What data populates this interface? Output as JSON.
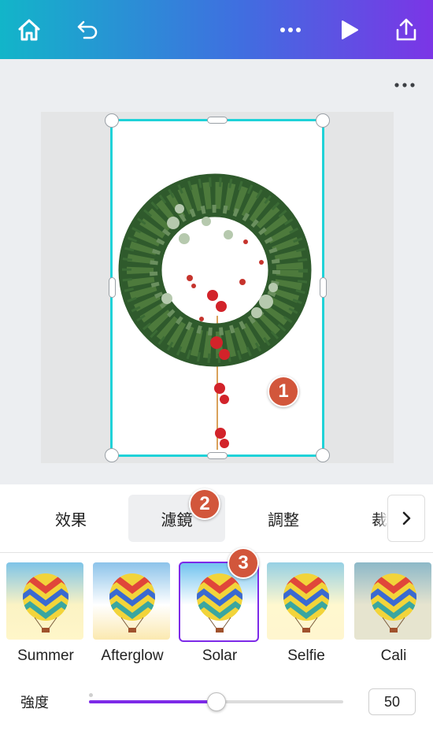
{
  "toolbar": {
    "icons": [
      "home-icon",
      "undo-icon",
      "more-icon",
      "play-icon",
      "share-icon"
    ],
    "gradient": [
      "#12b5c9",
      "#3f6fe0",
      "#7b35e6"
    ]
  },
  "canvas": {
    "selection_color": "#1fd2d8",
    "badges": [
      "1",
      "2",
      "3"
    ]
  },
  "tabs": [
    {
      "label": "效果"
    },
    {
      "label": "濾鏡"
    },
    {
      "label": "調整"
    },
    {
      "label": "裁"
    }
  ],
  "active_tab": "濾鏡",
  "filters": [
    {
      "name": "Summer"
    },
    {
      "name": "Afterglow"
    },
    {
      "name": "Solar"
    },
    {
      "name": "Selfie"
    },
    {
      "name": "Cali"
    }
  ],
  "selected_filter": "Solar",
  "intensity": {
    "label": "強度",
    "value": "50",
    "fraction": 0.5,
    "accent": "#7d2ae8"
  }
}
